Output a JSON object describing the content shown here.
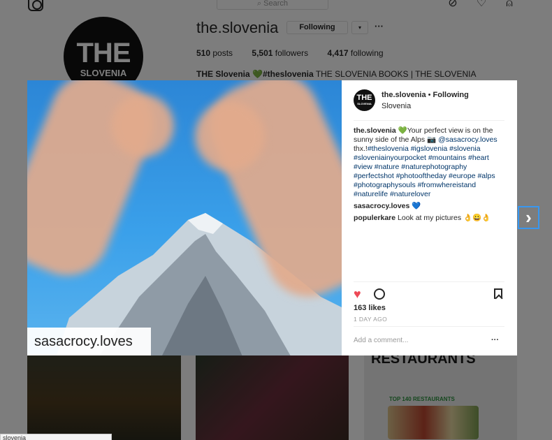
{
  "topbar": {
    "search_placeholder": "Search",
    "icons": [
      "instagram-icon",
      "compass-icon",
      "heart-icon",
      "user-icon"
    ]
  },
  "profile": {
    "avatar_line1": "THE",
    "avatar_line2": "SLOVENIA",
    "username": "the.slovenia",
    "following_button": "Following",
    "caret": "▾",
    "more": "···",
    "posts_count": "510",
    "posts_label": "posts",
    "followers_count": "5,501",
    "followers_label": "followers",
    "following_count": "4,417",
    "following_label": "following",
    "bio_name": "THE Slovenia",
    "bio_emoji": "💚",
    "bio_tag": "#theslovenia",
    "bio_text": "THE SLOVENIA BOOKS | THE SLOVENIA"
  },
  "thumbnails": {
    "third_heading": "RESTAURANTS",
    "third_sub": "TOP 140 RESTAURANTS"
  },
  "status_bar": {
    "url": "slovenia"
  },
  "post": {
    "watermark": "sasacrocy.loves",
    "avatar_line1": "THE",
    "avatar_line2": "SLOVENIA",
    "author": "the.slovenia",
    "separator": " • ",
    "follow_state": "Following",
    "location": "Slovenia",
    "caption_user": "the.slovenia",
    "caption_emoji": "💚",
    "caption_text": "Your perfect view is on the sunny side of the Alps 📷",
    "caption_mention": "@sasacrocy.loves",
    "caption_thanks": "thx.!",
    "hashtags": "#theslovenia #igslovenia #slovenia #sloveniainyourpocket #mountains #heart #view #nature #naturephotography #perfectshot #photooftheday #europe #alps #photographysouls #fromwhereistand #naturelife #naturelover",
    "comment1_user": "sasacrocy.loves",
    "comment1_text": "💙",
    "comment2_user": "populerkare",
    "comment2_text": "Look at my pictures 👌😀👌",
    "likes": "163 likes",
    "time_ago": "1 DAY AGO",
    "add_comment_placeholder": "Add a comment...",
    "comment_options": "···",
    "next_arrow": "›"
  },
  "colors": {
    "like_red": "#ed4956",
    "link_blue": "#003569",
    "focus_blue": "#3897f0"
  }
}
